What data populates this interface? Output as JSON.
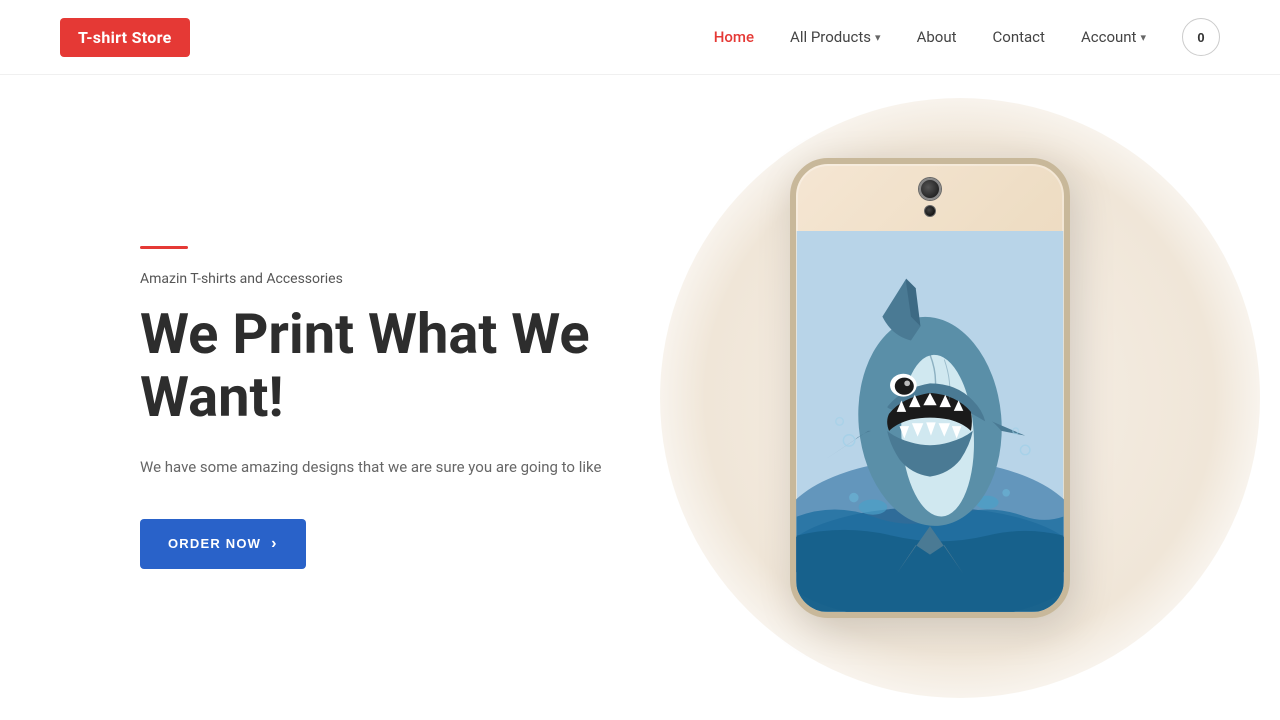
{
  "header": {
    "logo": "T-shirt Store",
    "nav": {
      "home": "Home",
      "all_products": "All Products",
      "about": "About",
      "contact": "Contact",
      "account": "Account"
    },
    "cart_count": "0"
  },
  "hero": {
    "red_line": true,
    "subtitle": "Amazin T-shirts and Accessories",
    "title_line1": "We Print What We",
    "title_line2": "Want!",
    "description": "We have some amazing designs that we are sure you are going to like",
    "cta_label": "ORDER NOW"
  }
}
